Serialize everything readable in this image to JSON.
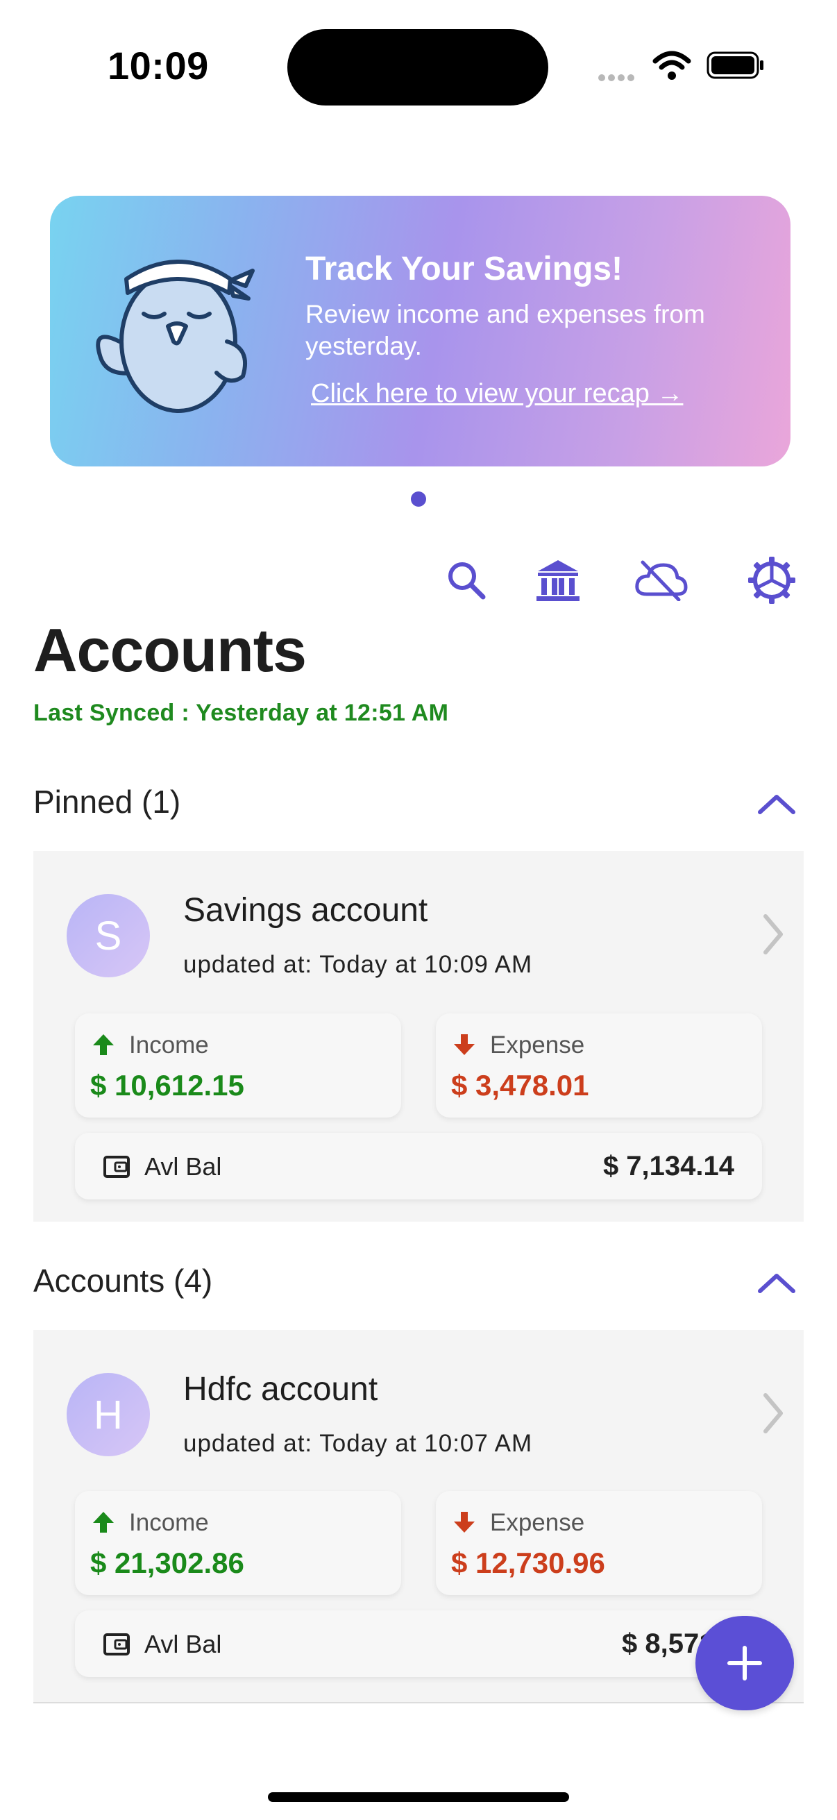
{
  "status_bar": {
    "time": "10:09"
  },
  "banner": {
    "title": "Track Your Savings!",
    "description": "Review income and expenses from yesterday.",
    "link": "Click here to view your recap →",
    "gradient": [
      "#78d3f0",
      "#a894ec",
      "#eaa6da"
    ]
  },
  "toolbar": {
    "icons": [
      "search-icon",
      "bank-icon",
      "cloud-off-icon",
      "settings-icon"
    ],
    "accent": "#5a4fcf"
  },
  "page": {
    "title": "Accounts",
    "last_synced": "Last Synced : Yesterday at 12:51 AM"
  },
  "pinned": {
    "header": "Pinned (1)",
    "accounts": [
      {
        "initial": "S",
        "name": "Savings account",
        "updated": "updated at: Today at 10:09 AM",
        "income_label": "Income",
        "income": "$ 10,612.15",
        "expense_label": "Expense",
        "expense": "$ 3,478.01",
        "balance_label": "Avl Bal",
        "balance": "$ 7,134.14"
      }
    ]
  },
  "accounts": {
    "header": "Accounts (4)",
    "items": [
      {
        "initial": "H",
        "name": "Hdfc account",
        "updated": "updated at: Today at 10:07 AM",
        "income_label": "Income",
        "income": "$ 21,302.86",
        "expense_label": "Expense",
        "expense": "$ 12,730.96",
        "balance_label": "Avl Bal",
        "balance": "$ 8,571."
      }
    ]
  },
  "colors": {
    "income": "#1a8a1a",
    "expense": "#cc3e1c",
    "synced": "#1f8a1f",
    "fab": "#5b4fd6"
  }
}
